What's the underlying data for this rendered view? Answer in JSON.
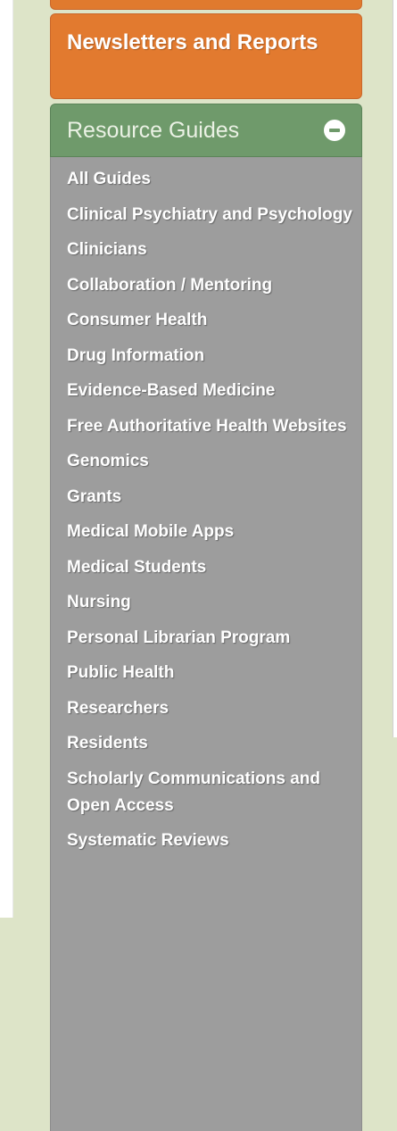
{
  "nav": {
    "newsletters_label": "Newsletters and Reports",
    "resource_guides": {
      "title": "Resource Guides",
      "expanded": true,
      "toggle_icon": "minus-circle-icon",
      "items": [
        {
          "label": "All Guides"
        },
        {
          "label": "Clinical Psychiatry and Psychology"
        },
        {
          "label": "Clinicians"
        },
        {
          "label": "Collaboration / Mentoring"
        },
        {
          "label": "Consumer Health"
        },
        {
          "label": "Drug Information"
        },
        {
          "label": "Evidence-Based Medicine"
        },
        {
          "label": "Free Authoritative Health Websites"
        },
        {
          "label": "Genomics"
        },
        {
          "label": "Grants"
        },
        {
          "label": "Medical Mobile Apps"
        },
        {
          "label": "Medical Students"
        },
        {
          "label": "Nursing"
        },
        {
          "label": "Personal Librarian Program"
        },
        {
          "label": "Public Health"
        },
        {
          "label": "Researchers"
        },
        {
          "label": "Residents"
        },
        {
          "label": "Scholarly Communications and Open Access"
        },
        {
          "label": "Systematic Reviews"
        }
      ]
    }
  },
  "colors": {
    "orange_button": "#e27a2f",
    "green_header": "#6f9a6b",
    "list_background": "#9d9d9d",
    "page_background": "#dde4c8"
  }
}
